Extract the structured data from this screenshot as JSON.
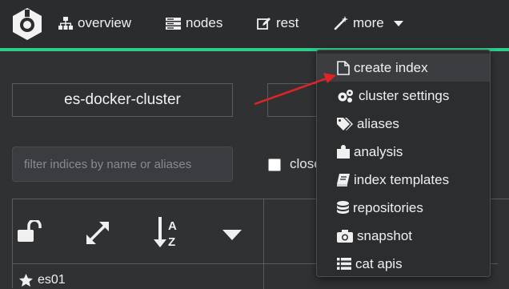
{
  "navbar": {
    "items": [
      {
        "label": "overview",
        "icon": "sitemap-icon"
      },
      {
        "label": "nodes",
        "icon": "server-icon"
      },
      {
        "label": "rest",
        "icon": "edit-icon"
      },
      {
        "label": "more",
        "icon": "magic-wand-icon"
      }
    ],
    "accent_color": "#2ecc8a"
  },
  "cluster": {
    "name": "es-docker-cluster"
  },
  "filter": {
    "placeholder": "filter indices by name or aliases"
  },
  "closed": {
    "label": "closed"
  },
  "table": {
    "rows": [
      {
        "label": "es01",
        "icon": "star-icon"
      }
    ]
  },
  "more_menu": {
    "items": [
      {
        "label": "create index",
        "icon": "file-icon"
      },
      {
        "label": "cluster settings",
        "icon": "cogs-icon"
      },
      {
        "label": "aliases",
        "icon": "tags-icon"
      },
      {
        "label": "analysis",
        "icon": "puzzle-icon"
      },
      {
        "label": "index templates",
        "icon": "book-icon"
      },
      {
        "label": "repositories",
        "icon": "database-icon"
      },
      {
        "label": "snapshot",
        "icon": "camera-icon"
      },
      {
        "label": "cat apis",
        "icon": "list-icon"
      }
    ]
  },
  "annotation": {
    "arrow_color": "#e02424"
  }
}
